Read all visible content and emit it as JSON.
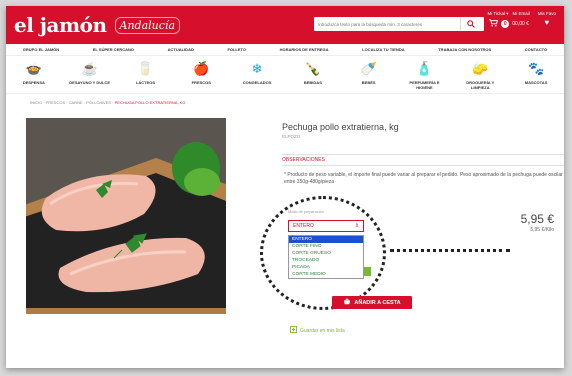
{
  "header": {
    "logo": "el jamón",
    "logo_sub": "Andalucía",
    "search_placeholder": "Introduzca texto para la búsqueda mín. 3 caracteres",
    "user_label": "Mi Tickal ▾",
    "email_label": "Mi Email",
    "cart_count": "0",
    "cart_total": "00,00 €",
    "favorites_label": "Mis Favo"
  },
  "nav": [
    "GRUPO EL JAMÓN",
    "EL SÚPER CERCANO",
    "ACTUALIDAD",
    "FOLLETO",
    "HORARIOS DE ENTREGA",
    "LOCALIZA TU TIENDA",
    "TRABAJA CON NOSOTROS",
    "CONTACTO"
  ],
  "categories": [
    {
      "label": "DESPENSA",
      "icon": "pot-icon",
      "glyph": "🍲"
    },
    {
      "label": "DESAYUNO Y DULCE",
      "icon": "coffee-icon",
      "glyph": "☕"
    },
    {
      "label": "LÁCTEOS",
      "icon": "milk-icon",
      "glyph": "🥛"
    },
    {
      "label": "FRESCOS",
      "icon": "fruit-icon",
      "glyph": "🍎"
    },
    {
      "label": "CONGELADOS",
      "icon": "snowflake-icon",
      "glyph": "❄"
    },
    {
      "label": "BEBIDAS",
      "icon": "bottle-icon",
      "glyph": "🍾"
    },
    {
      "label": "BEBÉS",
      "icon": "baby-icon",
      "glyph": "🍼"
    },
    {
      "label": "PERFUMERÍA E HIGIENE",
      "icon": "perfume-icon",
      "glyph": "🧴"
    },
    {
      "label": "DROGUERÍA Y LIMPIEZA",
      "icon": "cleaning-icon",
      "glyph": "🧽"
    },
    {
      "label": "MASCOTAS",
      "icon": "paw-icon",
      "glyph": "🐾"
    }
  ],
  "breadcrumb": {
    "items": "INICIO · FRESCOS · CARNE · POLLO/AVES ·",
    "current": "PECHUGA POLLO EXTRATIERNA, KG"
  },
  "product": {
    "title": "Pechuga pollo extratierna, kg",
    "brand": "ELPOZO",
    "observations_label": "OBSERVACIONES",
    "observations_text": "* Producto de peso variable, el importe final puede variar al preparar el pedido. Peso aproximado de la pechuga puede oscilar entre 350g-480g/pieza",
    "preparation_label": "Modo de preparación",
    "selected_option": "ENTERO",
    "options": [
      "ENTERO",
      "CORTE FINO",
      "CORTE GRUESO",
      "TROCEADO",
      "PICADA",
      "CORTE MEDIO"
    ],
    "price": "5,95 €",
    "unit_price": "5,95 €/Kilo",
    "add_to_cart": "AÑADIR A CESTA",
    "wishlist": "Guardar en mis lista"
  },
  "colors": {
    "brand_red": "#d60f2c",
    "green": "#7bb92f",
    "selection_blue": "#1f4fd1"
  }
}
